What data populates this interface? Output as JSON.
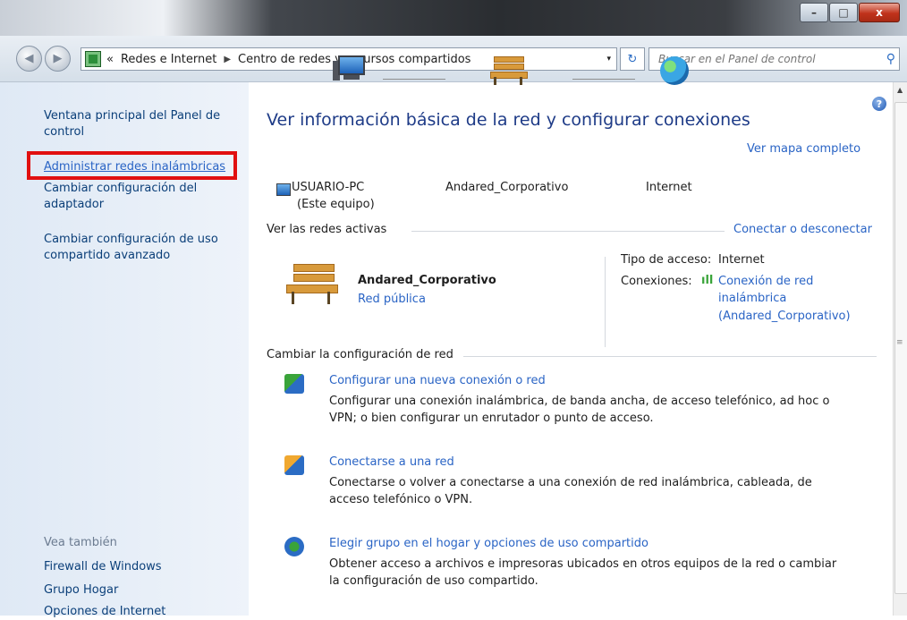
{
  "window": {
    "buttons": {
      "minimize": "–",
      "maximize": "□",
      "close": "x"
    }
  },
  "toolbar": {
    "back_label": "◀",
    "forward_label": "▶",
    "breadcrumb_prefix": "«",
    "breadcrumb": [
      "Redes e Internet",
      "Centro de redes y recursos compartidos"
    ],
    "breadcrumb_separator": "▶",
    "dropdown": "▾",
    "refresh": "↻",
    "search_placeholder": "Buscar en el Panel de control"
  },
  "sidebar": {
    "items": [
      {
        "label": "Ventana principal del Panel de control",
        "link": false
      },
      {
        "label": "Administrar redes inalámbricas",
        "link": true,
        "highlighted": true
      },
      {
        "label": "Cambiar configuración del adaptador",
        "link": false
      },
      {
        "label": "Cambiar configuración de uso compartido avanzado",
        "link": false
      }
    ],
    "see_also_heading": "Vea también",
    "see_also": [
      "Firewall de Windows",
      "Grupo Hogar",
      "Opciones de Internet"
    ]
  },
  "main": {
    "help": "?",
    "title": "Ver información básica de la red y configurar conexiones",
    "full_map_link": "Ver mapa completo",
    "map": {
      "computer": "USUARIO-PC",
      "computer_sub": "(Este equipo)",
      "network": "Andared_Corporativo",
      "internet": "Internet"
    },
    "active_networks_heading": "Ver las redes activas",
    "connect_disconnect_link": "Conectar o desconectar",
    "active_network": {
      "name": "Andared_Corporativo",
      "type": "Red pública",
      "access_type_label": "Tipo de acceso:",
      "access_type_value": "Internet",
      "connections_label": "Conexiones:",
      "connection_lines": [
        "Conexión de red",
        "inalámbrica",
        "(Andared_Corporativo)"
      ]
    },
    "change_settings_heading": "Cambiar la configuración de red",
    "tasks": [
      {
        "title": "Configurar una nueva conexión o red",
        "desc": "Configurar una conexión inalámbrica, de banda ancha, de acceso telefónico, ad hoc o VPN; o bien configurar un enrutador o punto de acceso."
      },
      {
        "title": "Conectarse a una red",
        "desc": "Conectarse o volver a conectarse a una conexión de red inalámbrica, cableada, de acceso telefónico o VPN."
      },
      {
        "title": "Elegir grupo en el hogar y opciones de uso compartido",
        "desc": "Obtener acceso a archivos e impresoras ubicados en otros equipos de la red o cambiar la configuración de uso compartido."
      }
    ]
  },
  "colors": {
    "link": "#2a64c5",
    "title": "#1e3b87",
    "highlight_box": "#e11010",
    "sidebar_bg": "#dfe9f5"
  }
}
